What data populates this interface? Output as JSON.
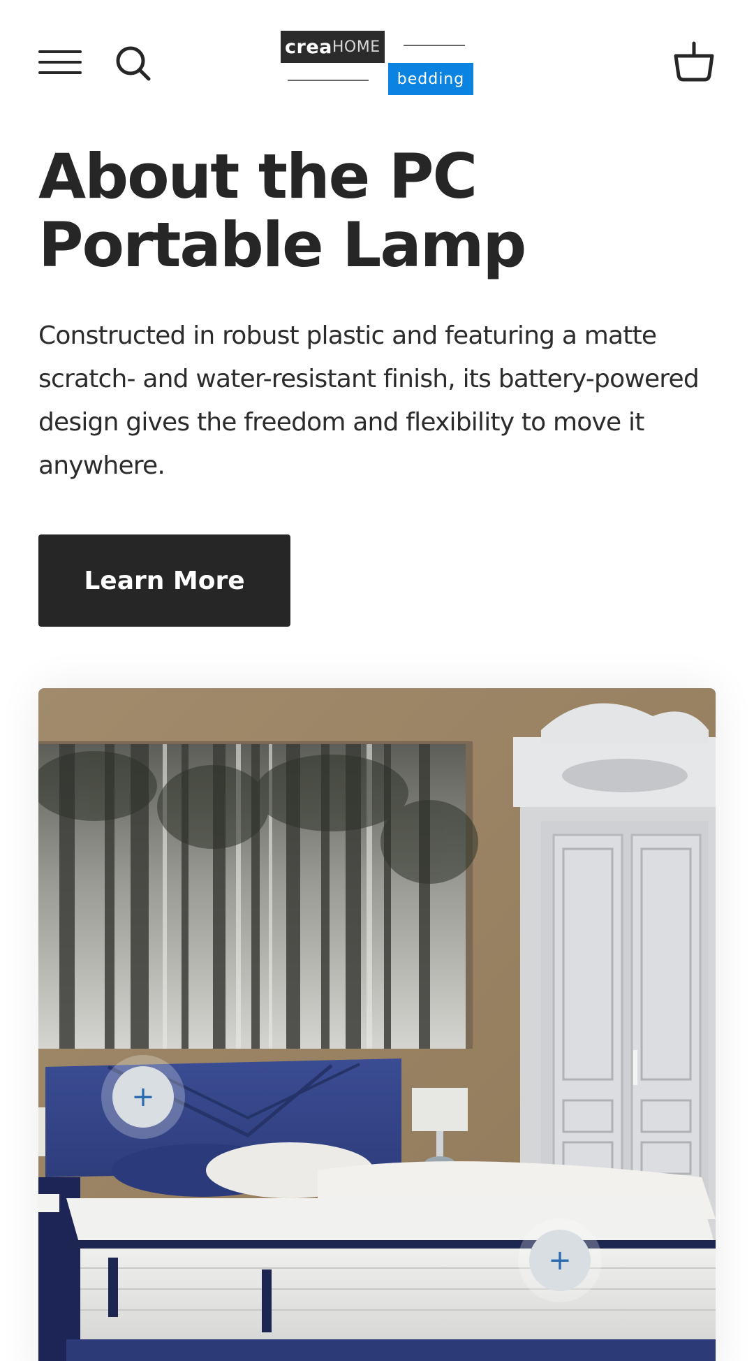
{
  "header": {
    "menu_icon": "hamburger-menu-icon",
    "search_icon": "search-icon",
    "cart_icon": "shopping-basket-icon",
    "logo": {
      "crea": "crea",
      "home": "HOME",
      "bedding": "bedding",
      "brand_dark": "#2b2b2b",
      "brand_blue": "#0a84e0"
    }
  },
  "main": {
    "title_line1": "About the PC",
    "title_line2": "Portable Lamp",
    "description": "Constructed in robust plastic and featuring a matte scratch- and water-resistant finish, its battery-powered design gives the freedom and flexibility to move it anywhere.",
    "cta_label": "Learn More"
  },
  "image_card": {
    "hotspots": [
      {
        "label": "+"
      },
      {
        "label": "+"
      }
    ]
  },
  "colors": {
    "text": "#262626",
    "button_bg": "#262626",
    "hotspot_plus": "#2b6cb0"
  }
}
